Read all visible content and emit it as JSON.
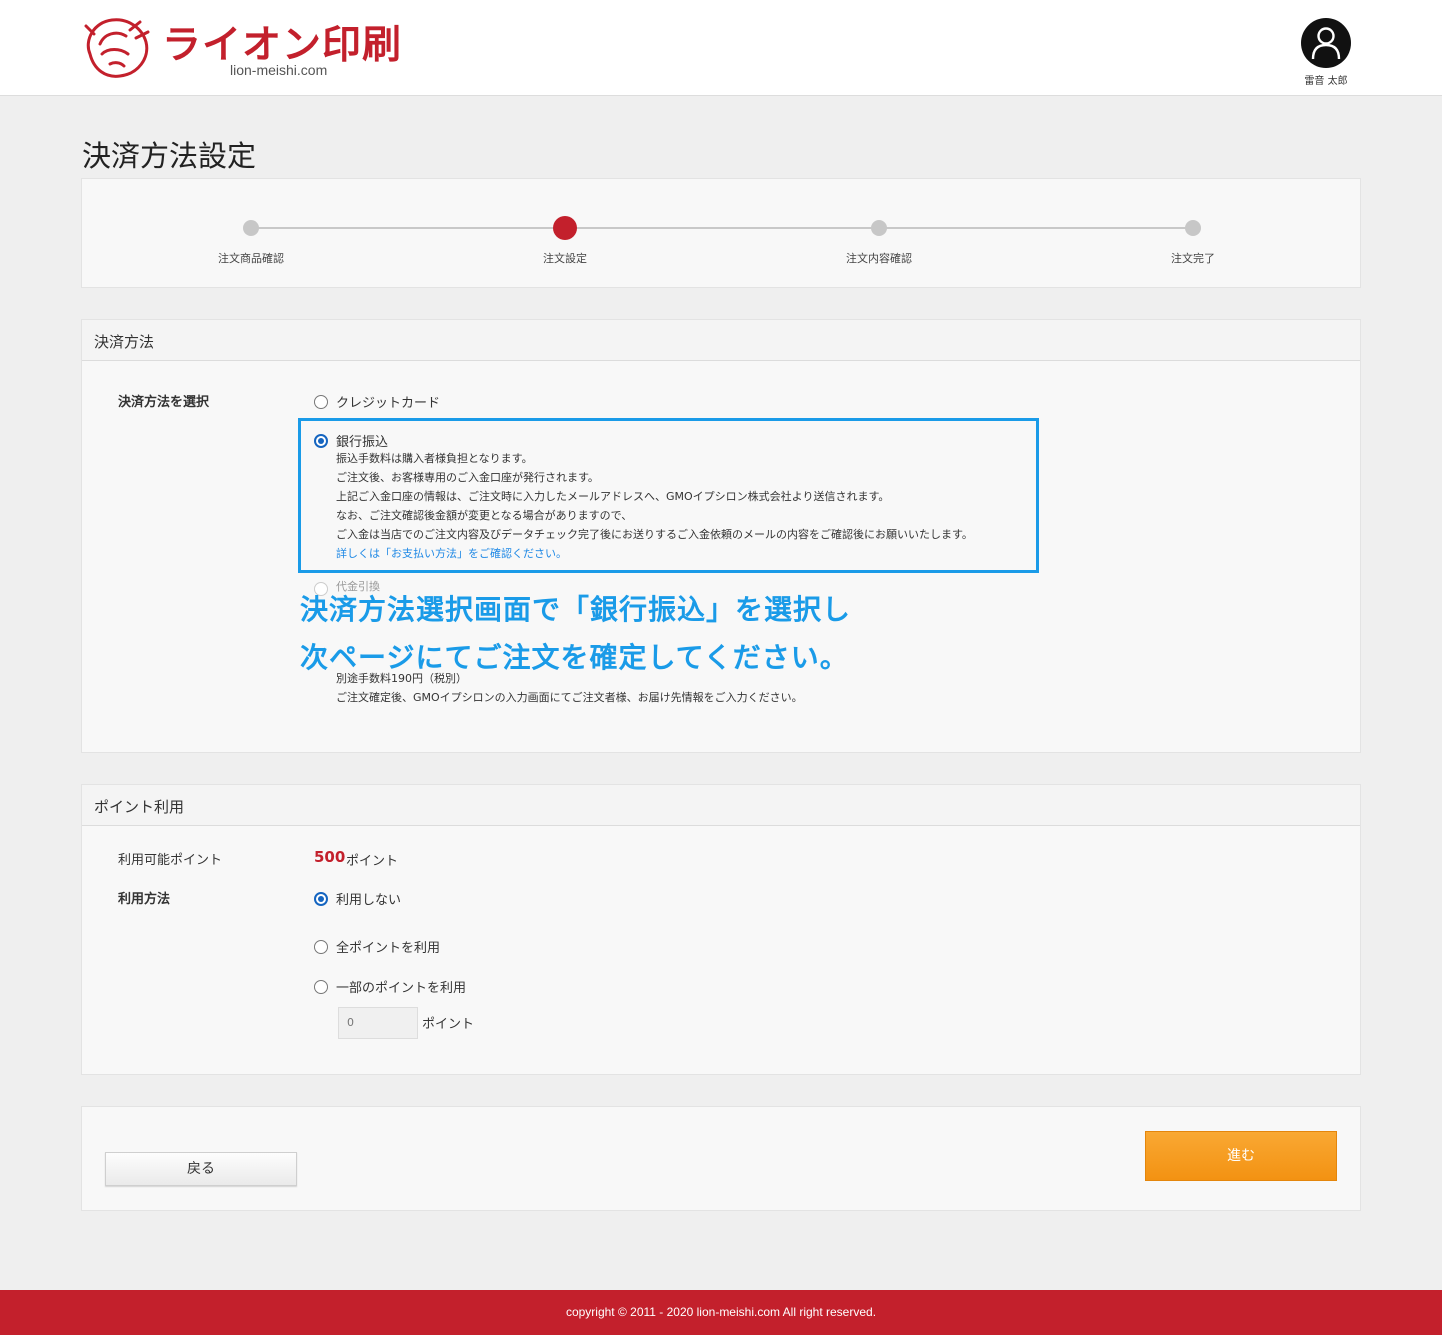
{
  "header": {
    "logo_text": "ライオン印刷",
    "logo_sub": "lion-meishi.com",
    "user_name": "雷音 太郎",
    "icons": {
      "logo": "lion-head-icon",
      "user": "user-avatar-icon"
    }
  },
  "page_title": "決済方法設定",
  "stepper": {
    "steps": [
      {
        "label": "注文商品確認",
        "state": "inactive"
      },
      {
        "label": "注文設定",
        "state": "active"
      },
      {
        "label": "注文内容確認",
        "state": "inactive"
      },
      {
        "label": "注文完了",
        "state": "inactive"
      }
    ]
  },
  "payment": {
    "section_title": "決済方法",
    "field_label": "決済方法を選択",
    "options": [
      {
        "label": "クレジットカード",
        "checked": false
      },
      {
        "label": "銀行振込",
        "checked": true,
        "desc": [
          "振込手数料は購入者様負担となります。",
          "ご注文後、お客様専用のご入金口座が発行されます。",
          "上記ご入金口座の情報は、ご注文時に入力したメールアドレスへ、GMOイプシロン株式会社より送信されます。",
          "なお、ご注文確認後金額が変更となる場合がありますので、",
          "ご入金は当店でのご注文内容及びデータチェック完了後にお送りするご入金依頼のメールの内容をご確認後にお願いいたします。"
        ],
        "link": "詳しくは「お支払い方法」をご確認ください。"
      },
      {
        "label": "代金引換",
        "checked": false,
        "desc": [
          "別途手数料190円（税別）",
          "ご注文確定後、GMOイプシロンの入力画面にてご注文者様、お届け先情報をご入力ください。"
        ]
      }
    ],
    "overlay_lines": [
      "決済方法選択画面で「銀行振込」を選択し",
      "次ページにてご注文を確定してください。"
    ]
  },
  "points": {
    "section_title": "ポイント利用",
    "available_label": "利用可能ポイント",
    "available_value": "500",
    "available_unit": "ポイント",
    "method_label": "利用方法",
    "options": [
      {
        "label": "利用しない",
        "checked": true
      },
      {
        "label": "全ポイントを利用",
        "checked": false
      },
      {
        "label": "一部のポイントを利用",
        "checked": false
      }
    ],
    "input_value": "0",
    "input_unit": "ポイント"
  },
  "actions": {
    "back_label": "戻る",
    "next_label": "進む"
  },
  "footer": {
    "copyright": "copyright © 2011 - 2020 lion-meishi.com All right reserved."
  },
  "colors": {
    "brand_red": "#c3202c",
    "highlight_blue": "#1a9be8",
    "next_orange": "#f39212"
  }
}
